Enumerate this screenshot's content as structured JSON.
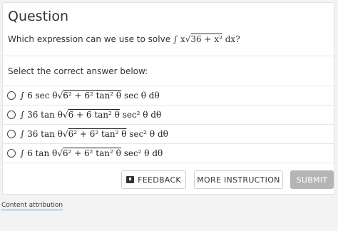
{
  "question": {
    "header": "Question",
    "prompt_text": "Which expression can we use to solve",
    "prompt_math_prefix": "∫ x",
    "prompt_math_radicand": "36 + x²",
    "prompt_math_suffix": " dx?",
    "instruction": "Select the correct answer below:"
  },
  "options": [
    {
      "prefix": "∫ 6 sec θ",
      "radicand": "6² + 6² tan² θ",
      "suffix": "  sec θ dθ"
    },
    {
      "prefix": "∫ 36 tan θ",
      "radicand": "6 + 6 tan² θ",
      "suffix": "  sec² θ dθ"
    },
    {
      "prefix": "∫ 36 tan θ",
      "radicand": "6² + 6² tan² θ",
      "suffix": "  sec² θ dθ"
    },
    {
      "prefix": "∫ 6 tan θ",
      "radicand": "6² + 6² tan² θ",
      "suffix": "  sec² θ dθ"
    }
  ],
  "buttons": {
    "feedback": "FEEDBACK",
    "more_instruction": "MORE INSTRUCTION",
    "submit": "SUBMIT"
  },
  "footer": {
    "attribution": "Content attribution"
  },
  "colors": {
    "submit_bg": "#b5b5b5",
    "link_underline": "#5a9bd4"
  }
}
